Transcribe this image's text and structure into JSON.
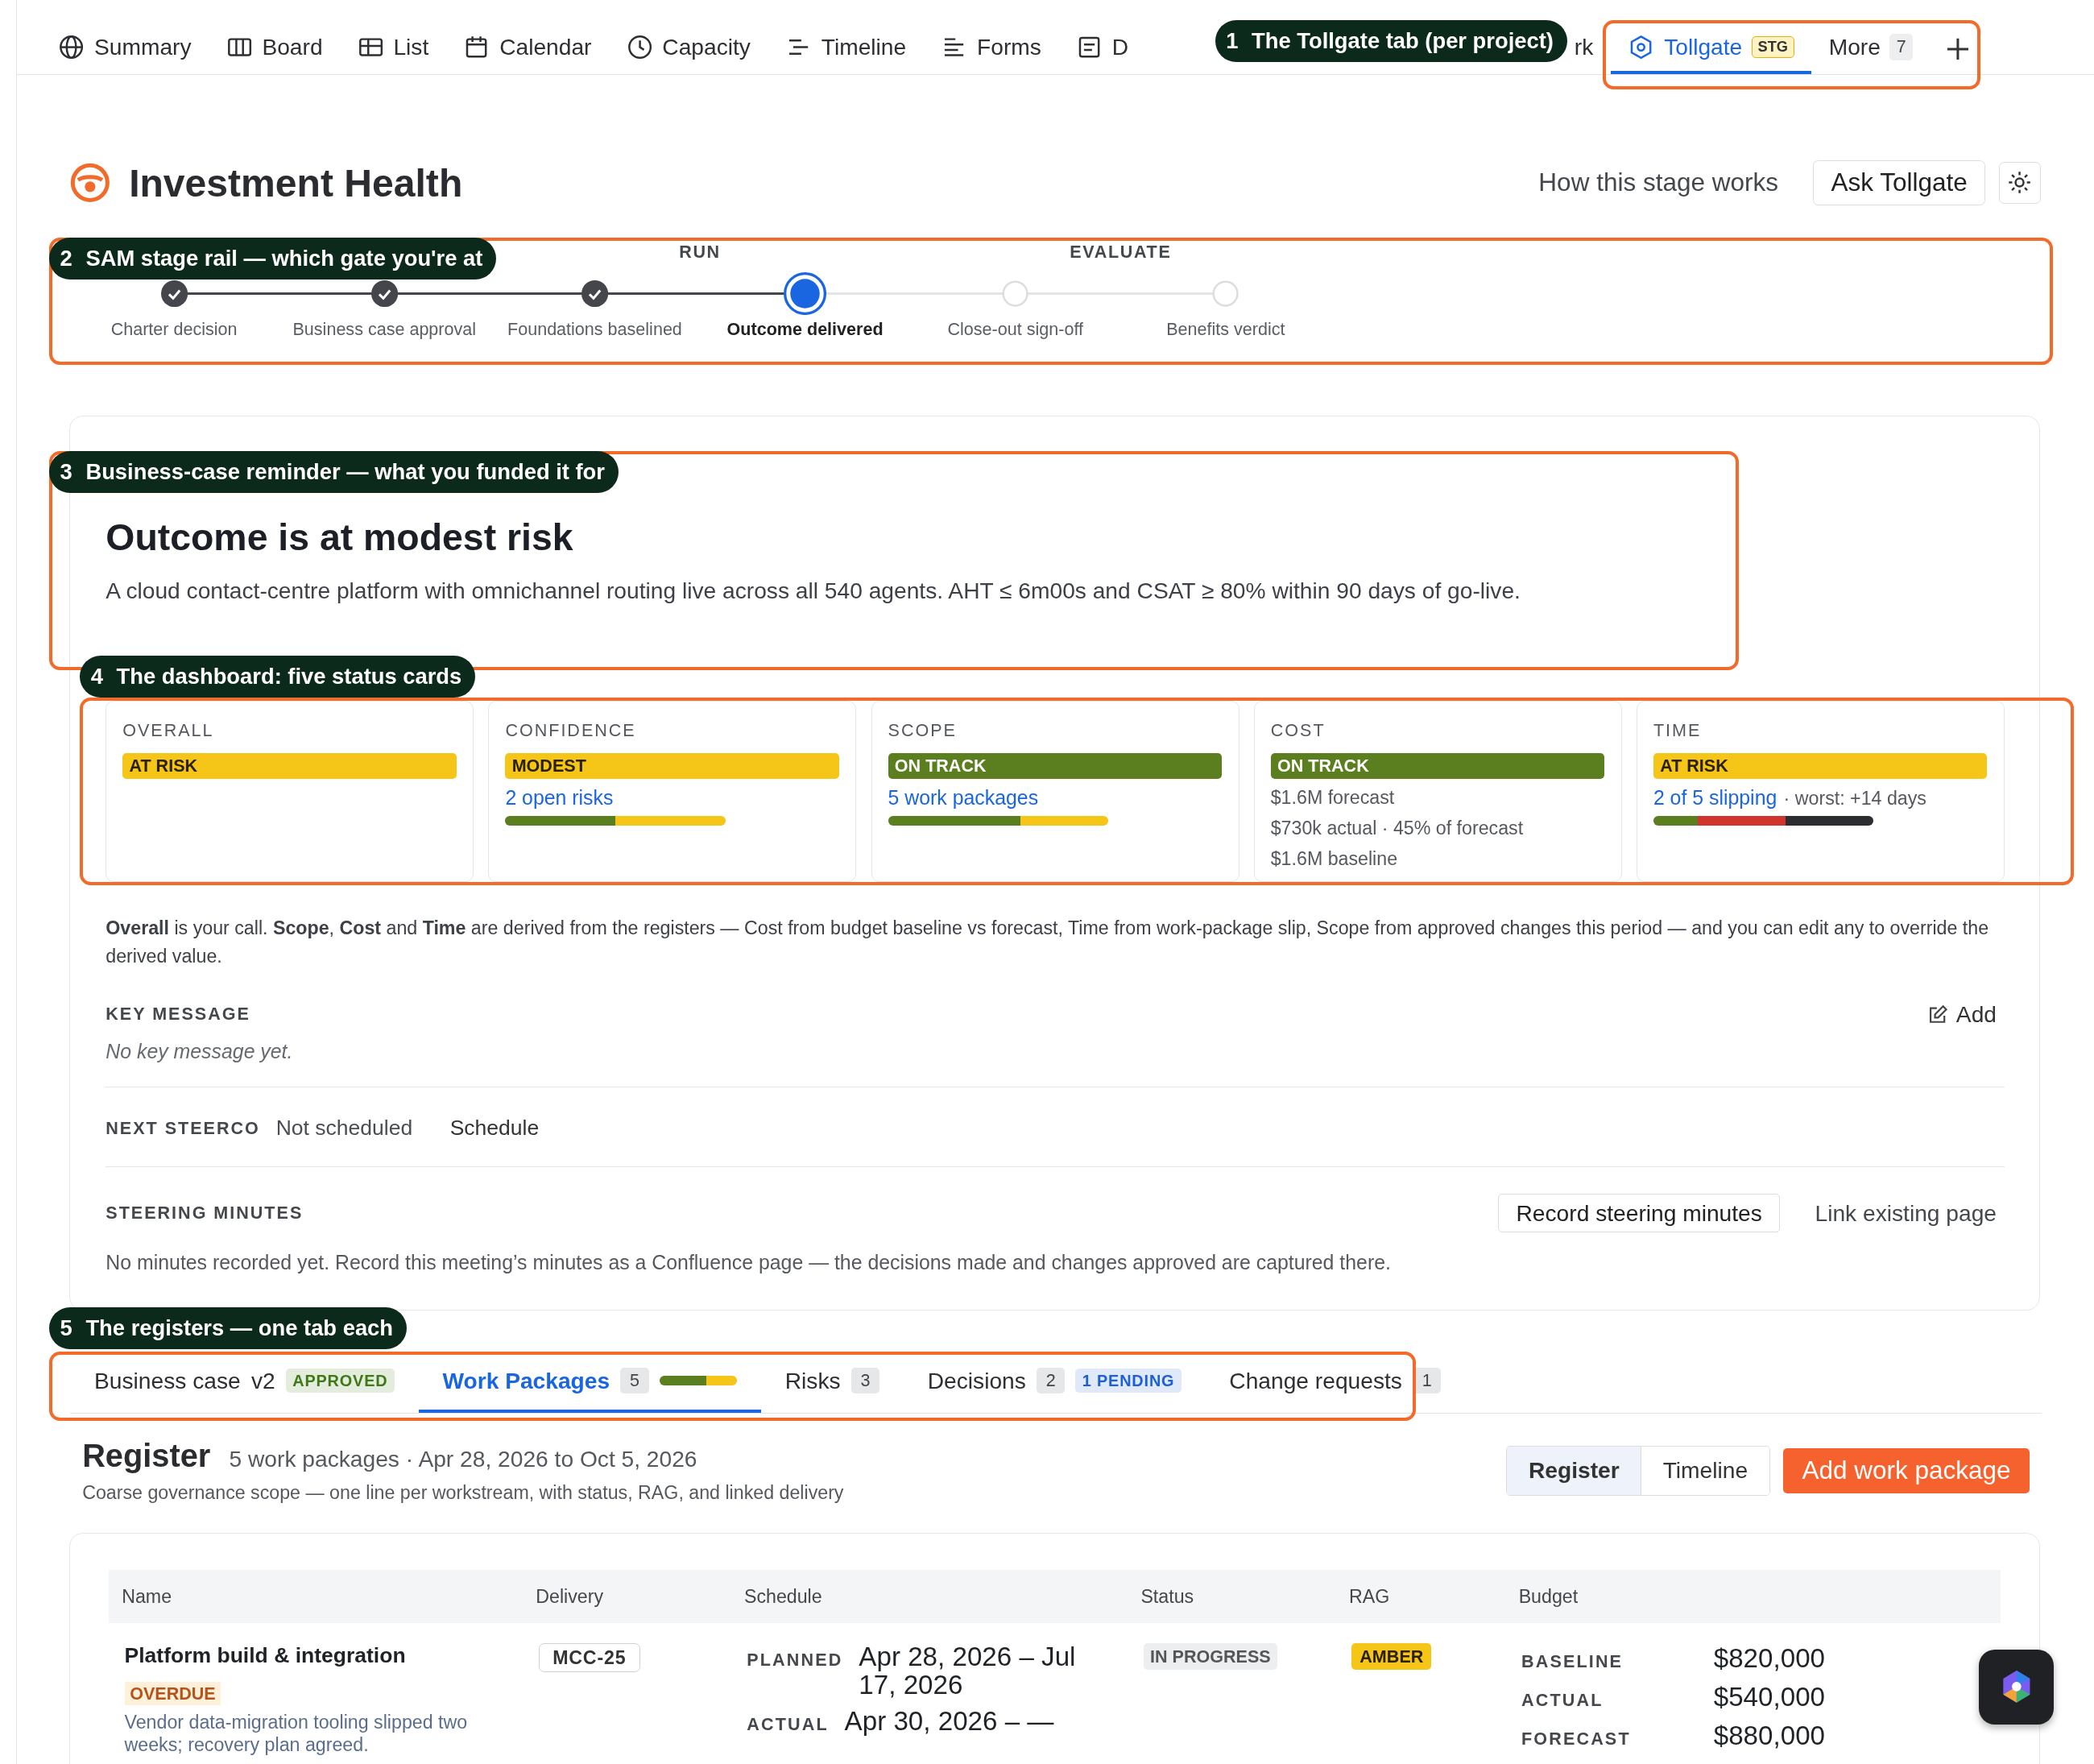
{
  "nav_tabs": [
    {
      "label": "Summary",
      "selected": false
    },
    {
      "label": "Board",
      "selected": false
    },
    {
      "label": "List",
      "selected": false
    },
    {
      "label": "Calendar",
      "selected": false
    },
    {
      "label": "Capacity",
      "selected": false
    },
    {
      "label": "Timeline",
      "selected": false
    },
    {
      "label": "Forms",
      "selected": false
    },
    {
      "label": "D",
      "selected": false
    },
    {
      "label": "rk",
      "selected": false
    },
    {
      "label": "Tollgate",
      "badge": "STG",
      "selected": true
    },
    {
      "label": "More",
      "count": "7",
      "selected": false
    }
  ],
  "header": {
    "title": "Investment Health",
    "help_link": "How this stage works",
    "ask_button": "Ask Tollgate"
  },
  "stage_rail": {
    "phases": [
      "RUN",
      "EVALUATE"
    ],
    "stages": [
      {
        "label": "Charter decision",
        "done": true,
        "current": false
      },
      {
        "label": "Business case approval",
        "done": true,
        "current": false
      },
      {
        "label": "Foundations baselined",
        "done": true,
        "current": false
      },
      {
        "label": "Outcome delivered",
        "done": false,
        "current": true
      },
      {
        "label": "Close-out sign-off",
        "done": false,
        "current": false
      },
      {
        "label": "Benefits verdict",
        "done": false,
        "current": false
      }
    ]
  },
  "reminder": {
    "title": "Outcome is at modest risk",
    "text": "A cloud contact-centre platform with omnichannel routing live across all 540 agents. AHT ≤ 6m00s and CSAT ≥ 80% within 90 days of go-live."
  },
  "status_cards": [
    {
      "label": "OVERALL",
      "status": "AT RISK",
      "color": "#f5c518"
    },
    {
      "label": "CONFIDENCE",
      "status": "MODEST",
      "color": "#f5c518",
      "link": "2 open risks",
      "bar": [
        {
          "color": "#5b7f1f",
          "level": 0.5
        },
        {
          "color": "#f5c518",
          "level": 0.5
        }
      ]
    },
    {
      "label": "SCOPE",
      "status": "ON TRACK",
      "color": "#5b7f1f",
      "link": "5 work packages",
      "bar": [
        {
          "color": "#5b7f1f",
          "level": 0.6
        },
        {
          "color": "#f5c518",
          "level": 0.4
        }
      ]
    },
    {
      "label": "COST",
      "status": "ON TRACK",
      "color": "#5b7f1f",
      "lines": [
        "$1.6M forecast",
        "$730k actual · 45% of forecast",
        "$1.6M baseline"
      ]
    },
    {
      "label": "TIME",
      "status": "AT RISK",
      "color": "#f5c518",
      "link": "2 of 5 slipping",
      "note": "· worst: +14 days",
      "bar": [
        {
          "color": "#5b7f1f",
          "level": 0.2
        },
        {
          "color": "#d0342c",
          "level": 0.4
        },
        {
          "color": "#2b2d31",
          "level": 0.4
        }
      ]
    }
  ],
  "explanation": "**Overall** is your call. **Scope**, **Cost** and **Time** are derived from the registers — Cost from budget baseline vs forecast, Time from work-package slip, Scope from approved changes this period — and you can edit any to override the derived value.",
  "key_message": {
    "label": "KEY MESSAGE",
    "action": "Add",
    "placeholder": "No key message yet."
  },
  "next_steerco": {
    "label": "NEXT STEERCO",
    "value": "Not scheduled",
    "action": "Schedule"
  },
  "steering_minutes": {
    "label": "STEERING MINUTES",
    "buttons": [
      "Record steering minutes",
      "Link existing page"
    ],
    "text": "No minutes recorded yet. Record this meeting’s minutes as a Confluence page — the decisions made and changes approved are captured there."
  },
  "register_tabs": [
    {
      "label": "Business case",
      "version": "v2",
      "badge": {
        "text": "APPROVED",
        "color": "#3d7a16"
      },
      "selected": false
    },
    {
      "label": "Work Packages",
      "count": "5",
      "bar": [
        {
          "color": "#5b7f1f",
          "level": 0.6
        },
        {
          "color": "#f5c518",
          "level": 0.4
        }
      ],
      "selected": true
    },
    {
      "label": "Risks",
      "count": "3",
      "selected": false
    },
    {
      "label": "Decisions",
      "count": "2",
      "badge": {
        "text": "1 PENDING",
        "color": "#1d5fd6"
      },
      "selected": false
    },
    {
      "label": "Change requests",
      "count": "1",
      "selected": false
    }
  ],
  "register": {
    "title": "Register",
    "summary": "5 work packages · Apr 28, 2026 to Oct 5, 2026",
    "subtitle": "Coarse governance scope — one line per workstream, with status, RAG, and linked delivery",
    "views": [
      {
        "label": "Register",
        "selected": true
      },
      {
        "label": "Timeline",
        "selected": false
      }
    ],
    "add_button": "Add work package"
  },
  "table": {
    "columns": [
      "Name",
      "Delivery",
      "Schedule",
      "Status",
      "RAG",
      "Budget"
    ],
    "rows": [
      {
        "name": "Platform build & integration",
        "flag": "OVERDUE",
        "note": "Vendor data-migration tooling slipped two weeks; recovery plan agreed.",
        "delivery": "MCC-25",
        "schedule": [
          {
            "label": "PLANNED",
            "dates": "Apr 28, 2026 – Jul 17, 2026"
          },
          {
            "label": "ACTUAL",
            "dates": "Apr 30, 2026 – —"
          }
        ],
        "status": "IN PROGRESS",
        "rag": {
          "text": "AMBER",
          "color": "#f5c518"
        },
        "budget": [
          {
            "label": "BASELINE",
            "value": "$820,000"
          },
          {
            "label": "ACTUAL",
            "value": "$540,000"
          },
          {
            "label": "FORECAST",
            "value": "$880,000"
          }
        ]
      }
    ]
  },
  "callouts": [
    {
      "number": "1",
      "text": "The Tollgate tab (per project)"
    },
    {
      "number": "2",
      "text": "SAM stage rail — which gate you're at"
    },
    {
      "number": "3",
      "text": "Business-case reminder — what you funded it for"
    },
    {
      "number": "4",
      "text": "The dashboard: five status cards"
    },
    {
      "number": "5",
      "text": "The registers — one tab each"
    }
  ]
}
